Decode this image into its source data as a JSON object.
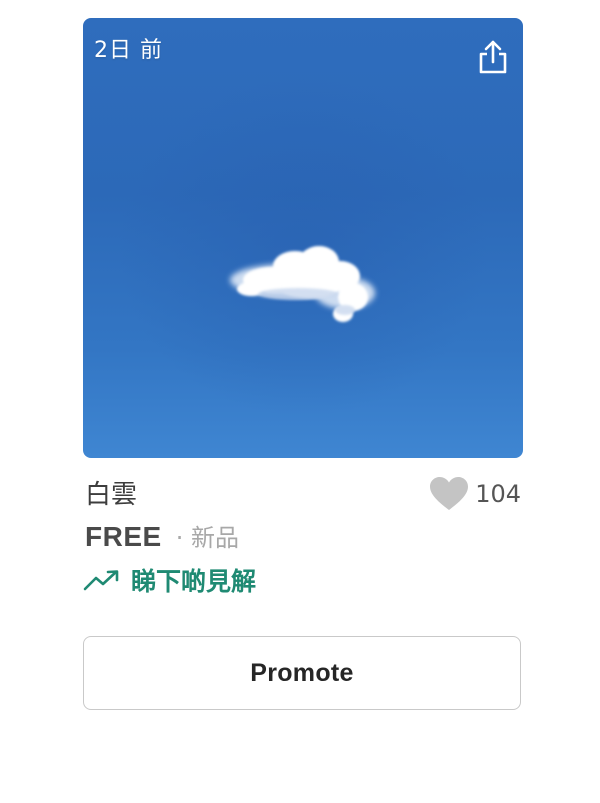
{
  "listing": {
    "posted": "2日 前",
    "title": "白雲",
    "likes": "104",
    "price": "FREE",
    "condition": "· 新品",
    "insights_label": "睇下啲見解",
    "promote_label": "Promote"
  },
  "icons": {
    "share": "share-icon",
    "like": "heart-icon",
    "insights": "trending-up-icon"
  },
  "colors": {
    "sky": "#2f6dbd",
    "accent_green": "#1f8a73",
    "heart_gray": "#c4c4c4",
    "price_text": "#4a4a4a",
    "muted_text": "#a8a8a8"
  }
}
